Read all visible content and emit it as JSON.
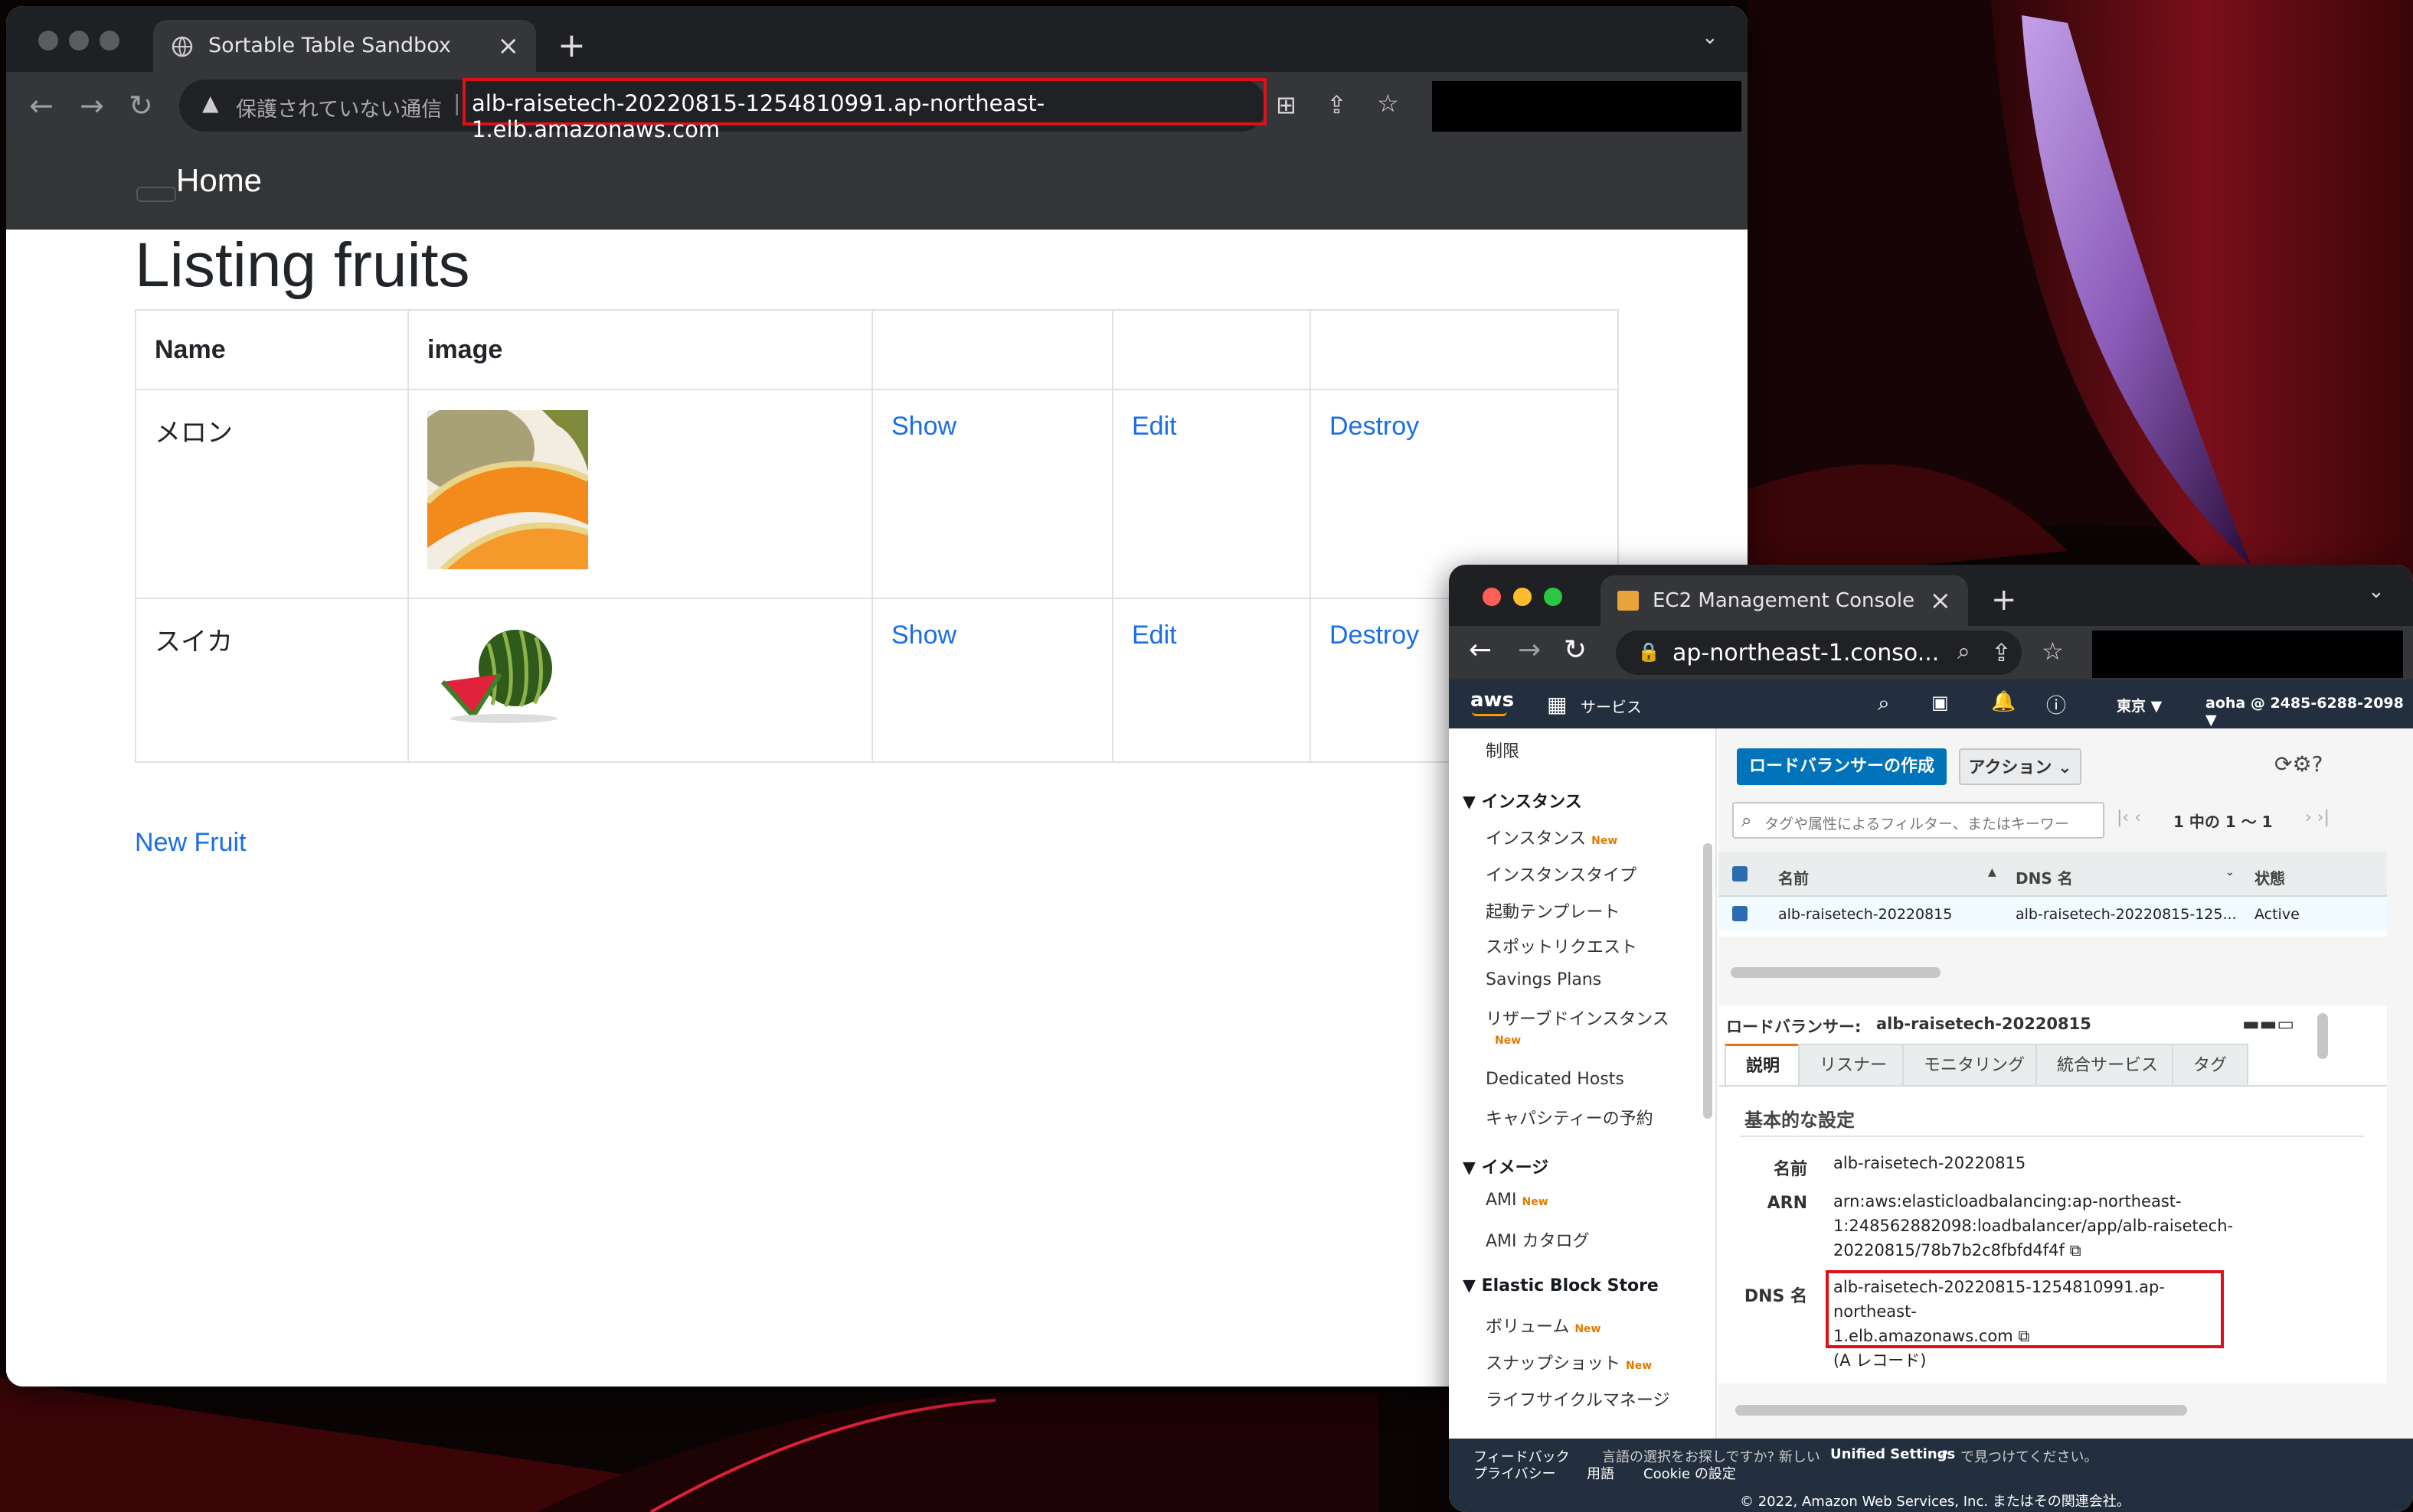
{
  "browser1": {
    "tab_title": "Sortable Table Sandbox",
    "security_label": "保護されていない通信",
    "url": "alb-raisetech-20220815-1254810991.ap-northeast-1.elb.amazonaws.com"
  },
  "app": {
    "nav_home": "Home",
    "heading": "Listing fruits",
    "columns": [
      "Name",
      "image",
      "",
      "",
      ""
    ],
    "rows": [
      {
        "name": "メロン",
        "image_icon": "melon-image",
        "show": "Show",
        "edit": "Edit",
        "destroy": "Destroy"
      },
      {
        "name": "スイカ",
        "image_icon": "watermelon-image",
        "show": "Show",
        "edit": "Edit",
        "destroy": "Destroy"
      }
    ],
    "new_link": "New Fruit"
  },
  "browser2": {
    "tab_title": "EC2 Management Console",
    "url": "ap-northeast-1.conso..."
  },
  "aws_header": {
    "logo": "aws",
    "services": "サービス",
    "region": "東京 ▼",
    "account": "aoha @ 2485-6288-2098 ▼"
  },
  "sidebar": {
    "limit": "制限",
    "sec_instances": "▼ インスタンス",
    "instances": "インスタンス",
    "instance_types": "インスタンスタイプ",
    "launch_templates": "起動テンプレート",
    "spot_requests": "スポットリクエスト",
    "savings_plans": "Savings Plans",
    "reserved": "リザーブドインスタンス",
    "dedicated_hosts": "Dedicated Hosts",
    "capacity": "キャパシティーの予約",
    "sec_images": "▼ イメージ",
    "ami": "AMI",
    "ami_catalog": "AMI カタログ",
    "sec_ebs": "▼ Elastic Block Store",
    "volumes": "ボリューム",
    "snapshots": "スナップショット",
    "lifecycle": "ライフサイクルマネージ",
    "new_badge": "New"
  },
  "lb": {
    "create_btn": "ロードバランサーの作成",
    "action_btn": "アクション",
    "filter_placeholder": "タグや属性によるフィルター、またはキーワー",
    "pager": "1 中の 1 ～ 1",
    "col_name": "名前",
    "col_dns": "DNS 名",
    "col_state": "状態",
    "row_name": "alb-raisetech-20220815",
    "row_dns": "alb-raisetech-20220815-125...",
    "row_state": "Active",
    "detail_label": "ロードバランサー:",
    "detail_name": "alb-raisetech-20220815",
    "tabs": [
      "説明",
      "リスナー",
      "モニタリング",
      "統合サービス",
      "タグ"
    ],
    "basic": "基本的な設定",
    "k_name": "名前",
    "v_name": "alb-raisetech-20220815",
    "k_arn": "ARN",
    "v_arn_1": "arn:aws:elasticloadbalancing:ap-northeast-",
    "v_arn_2": "1:248562882098:loadbalancer/app/alb-raisetech-",
    "v_arn_3": "20220815/78b7b2c8fbfd4f4f",
    "k_dns": "DNS 名",
    "v_dns_1": "alb-raisetech-20220815-1254810991.ap-northeast-",
    "v_dns_2": "1.elb.amazonaws.com",
    "v_dns_3": "(A レコード)"
  },
  "footer": {
    "feedback": "フィードバック",
    "privacy": "プライバシー",
    "terms": "用語",
    "cookie": "Cookie の設定",
    "lang_text": "言語の選択をお探しですか? 新しい",
    "unified": "Unified Settings",
    "lang_tail": "で見つけてください。",
    "copyright": "© 2022, Amazon Web Services, Inc. またはその関連会社。"
  },
  "colors": {
    "link": "#1a6ee8",
    "aws_orange": "#ec7211",
    "aws_blue": "#0073bb",
    "highlight_red": "#e0101a"
  }
}
